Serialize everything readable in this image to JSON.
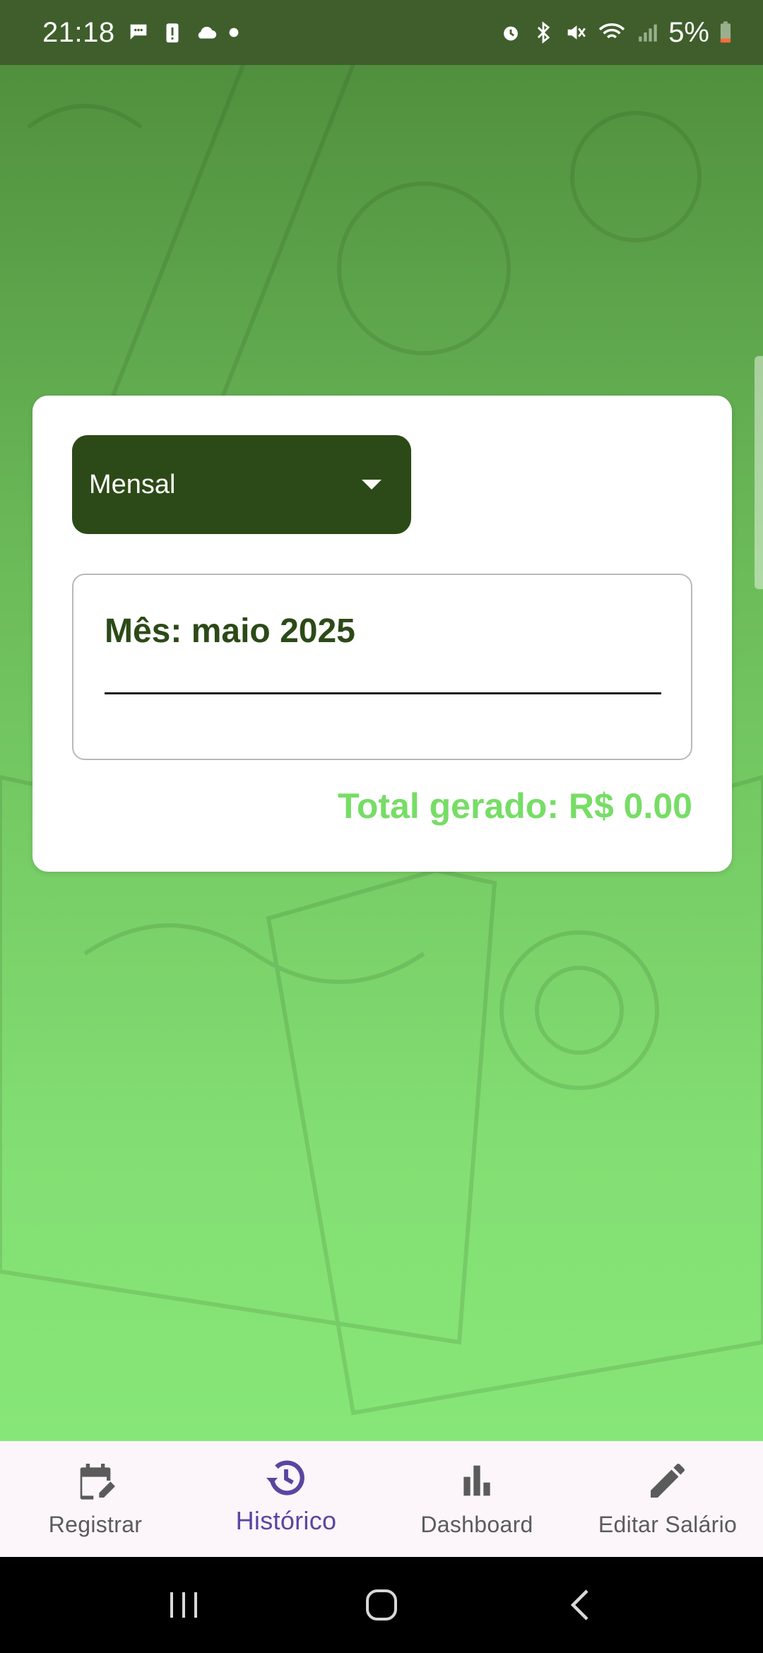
{
  "status_bar": {
    "time": "21:18",
    "battery_percent": "5%",
    "left_icons": [
      "chat-bubble-icon",
      "battery-alert-icon",
      "cloud-icon",
      "dot-icon"
    ],
    "right_icons": [
      "alarm-icon",
      "bluetooth-icon",
      "mute-icon",
      "wifi-icon",
      "signal-icon",
      "battery-icon"
    ]
  },
  "filter": {
    "selected_period": "Mensal"
  },
  "summary": {
    "month_title": "Mês: maio 2025",
    "total_label": "Total gerado: R$ 0.00"
  },
  "bottom_nav": {
    "items": [
      {
        "label": "Registrar",
        "icon": "calendar-edit-icon",
        "active": false
      },
      {
        "label": "Histórico",
        "icon": "history-icon",
        "active": true
      },
      {
        "label": "Dashboard",
        "icon": "bar-chart-icon",
        "active": false
      },
      {
        "label": "Editar Salário",
        "icon": "pencil-icon",
        "active": false
      }
    ]
  },
  "colors": {
    "primary_dark_green": "#2c4a17",
    "total_green": "#77dd66",
    "active_nav": "#5b45a0",
    "nav_background": "#fcf6fb"
  }
}
